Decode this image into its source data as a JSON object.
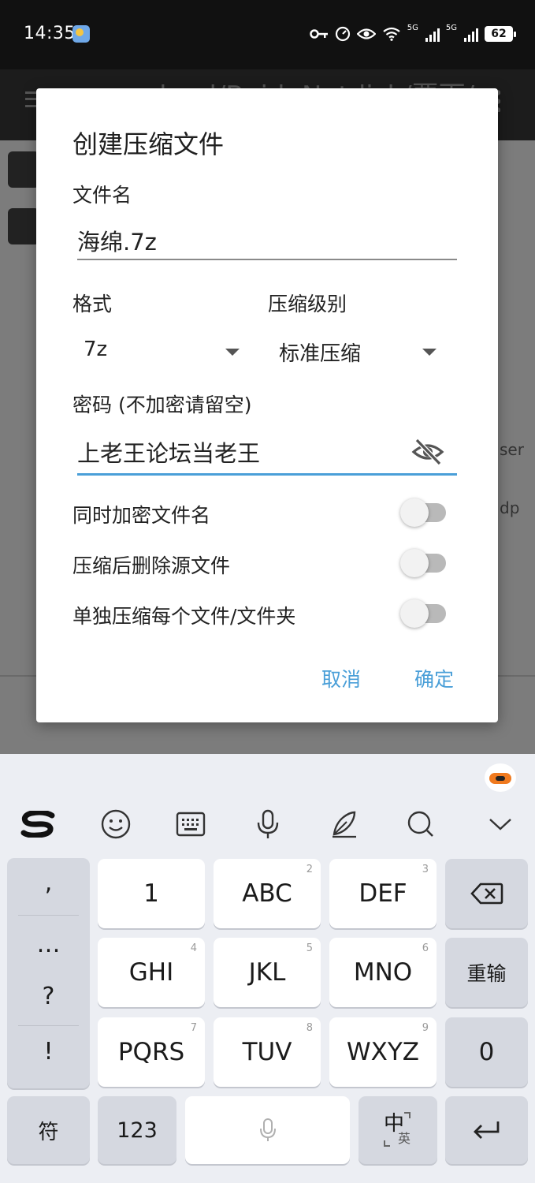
{
  "status_bar": {
    "time": "14:35",
    "network_label": "5G",
    "battery": "62"
  },
  "background": {
    "title": "ownload/BaiduNetdisk/要下/",
    "snippet1": "ser",
    "snippet2": "dp"
  },
  "dialog": {
    "title": "创建压缩文件",
    "filename_label": "文件名",
    "filename_value": "海绵.7z",
    "format_label": "格式",
    "format_value": "7z",
    "level_label": "压缩级别",
    "level_value": "标准压缩",
    "password_label": "密码 (不加密请留空)",
    "password_value": "上老王论坛当老王",
    "toggles": [
      {
        "label": "同时加密文件名",
        "on": false
      },
      {
        "label": "压缩后删除源文件",
        "on": false
      },
      {
        "label": "单独压缩每个文件/文件夹",
        "on": false
      }
    ],
    "cancel": "取消",
    "ok": "确定"
  },
  "keyboard": {
    "symbols": [
      ",",
      "…",
      "?",
      "!"
    ],
    "keys": [
      {
        "label": "1",
        "num": ""
      },
      {
        "label": "ABC",
        "num": "2"
      },
      {
        "label": "DEF",
        "num": "3"
      },
      {
        "label": "GHI",
        "num": "4"
      },
      {
        "label": "JKL",
        "num": "5"
      },
      {
        "label": "MNO",
        "num": "6"
      },
      {
        "label": "PQRS",
        "num": "7"
      },
      {
        "label": "TUV",
        "num": "8"
      },
      {
        "label": "WXYZ",
        "num": "9"
      }
    ],
    "reinput": "重输",
    "zero": "0",
    "symbol_key": "符",
    "num_key": "123",
    "lang_zh": "中",
    "lang_en": "英",
    "accent_color": "#4a9fd8"
  }
}
